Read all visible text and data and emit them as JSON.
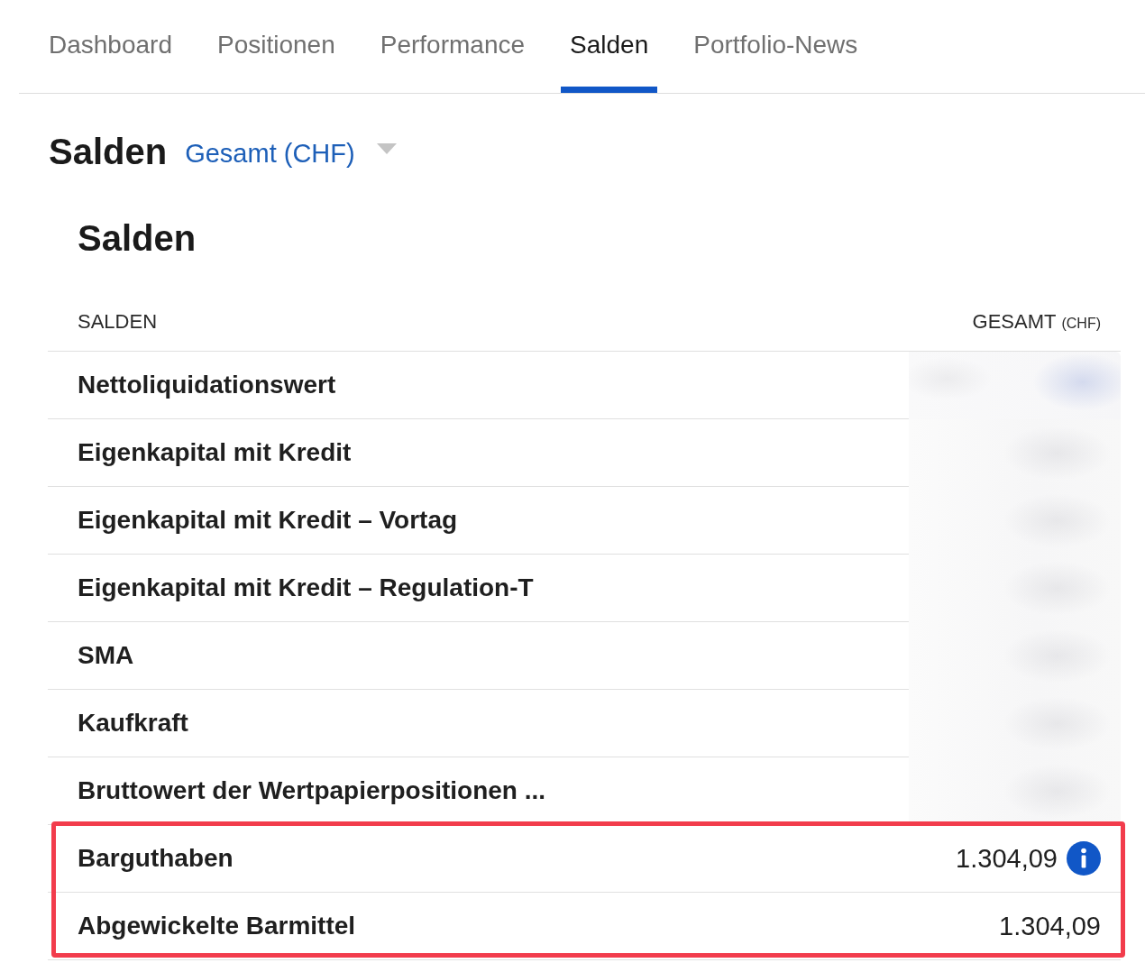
{
  "tabs": [
    {
      "label": "Dashboard",
      "selected": false
    },
    {
      "label": "Positionen",
      "selected": false
    },
    {
      "label": "Performance",
      "selected": false
    },
    {
      "label": "Salden",
      "selected": true
    },
    {
      "label": "Portfolio-News",
      "selected": false
    }
  ],
  "header": {
    "title": "Salden",
    "account_selector": {
      "value": "Gesamt (CHF)"
    }
  },
  "panel": {
    "title": "Salden",
    "table": {
      "columns": [
        {
          "label": "SALDEN"
        },
        {
          "label": "GESAMT",
          "unit": "(CHF)"
        }
      ],
      "rows": [
        {
          "label": "Nettoliquidationswert",
          "blurred": true,
          "info": false,
          "highlighted": false
        },
        {
          "label": "Eigenkapital mit Kredit",
          "blurred": true,
          "info": false,
          "highlighted": false
        },
        {
          "label": "Eigenkapital mit Kredit – Vortag",
          "blurred": true,
          "info": false,
          "highlighted": false
        },
        {
          "label": "Eigenkapital mit Kredit – Regulation-T",
          "blurred": true,
          "info": false,
          "highlighted": false
        },
        {
          "label": "SMA",
          "blurred": true,
          "info": false,
          "highlighted": false
        },
        {
          "label": "Kaufkraft",
          "blurred": true,
          "info": false,
          "highlighted": false
        },
        {
          "label": "Bruttowert der Wertpapierpositionen ...",
          "blurred": true,
          "info": false,
          "highlighted": false
        },
        {
          "label": "Barguthaben",
          "value": "1.304,09",
          "blurred": false,
          "info": true,
          "highlighted": true
        },
        {
          "label": "Abgewickelte Barmittel",
          "value": "1.304,09",
          "blurred": false,
          "info": false,
          "highlighted": true
        }
      ]
    }
  }
}
